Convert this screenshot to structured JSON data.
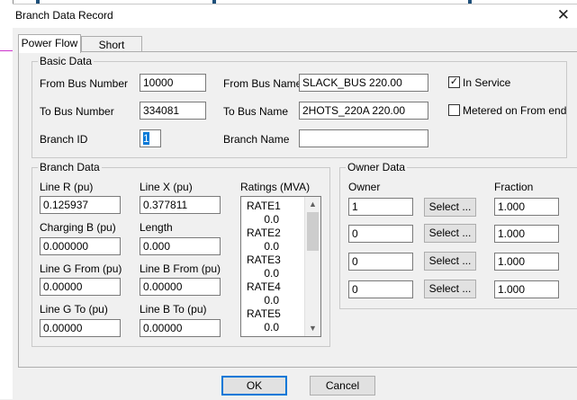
{
  "window": {
    "title": "Branch Data Record",
    "close_glyph": "✕"
  },
  "tabs": [
    {
      "label": "Power Flow",
      "active": true
    },
    {
      "label": "Short Circuit",
      "active": false
    }
  ],
  "basic_data": {
    "group_label": "Basic Data",
    "from_bus_number_label": "From Bus Number",
    "from_bus_number": "10000",
    "to_bus_number_label": "To Bus Number",
    "to_bus_number": "334081",
    "branch_id_label": "Branch ID",
    "branch_id": "1",
    "from_bus_name_label": "From Bus Name",
    "from_bus_name": "SLACK_BUS   220.00",
    "to_bus_name_label": "To Bus Name",
    "to_bus_name": "2HOTS_220A  220.00",
    "branch_name_label": "Branch Name",
    "branch_name": "",
    "in_service_label": "In Service",
    "in_service_checked": true,
    "metered_label": "Metered on From end",
    "metered_checked": false
  },
  "branch_data": {
    "group_label": "Branch Data",
    "line_r_label": "Line R (pu)",
    "line_r": "0.125937",
    "line_x_label": "Line X (pu)",
    "line_x": "0.377811",
    "charging_b_label": "Charging B (pu)",
    "charging_b": "0.000000",
    "length_label": "Length",
    "length": "0.000",
    "line_g_from_label": "Line G From (pu)",
    "line_g_from": "0.00000",
    "line_b_from_label": "Line B From (pu)",
    "line_b_from": "0.00000",
    "line_g_to_label": "Line G To (pu)",
    "line_g_to": "0.00000",
    "line_b_to_label": "Line B To (pu)",
    "line_b_to": "0.00000",
    "ratings_label": "Ratings (MVA)",
    "ratings": [
      {
        "name": "RATE1",
        "value": "0.0"
      },
      {
        "name": "RATE2",
        "value": "0.0"
      },
      {
        "name": "RATE3",
        "value": "0.0"
      },
      {
        "name": "RATE4",
        "value": "0.0"
      },
      {
        "name": "RATE5",
        "value": "0.0"
      }
    ]
  },
  "owner_data": {
    "group_label": "Owner Data",
    "owner_header": "Owner",
    "fraction_header": "Fraction",
    "select_label": "Select ...",
    "rows": [
      {
        "owner": "1",
        "fraction": "1.000"
      },
      {
        "owner": "0",
        "fraction": "1.000"
      },
      {
        "owner": "0",
        "fraction": "1.000"
      },
      {
        "owner": "0",
        "fraction": "1.000"
      }
    ]
  },
  "buttons": {
    "ok": "OK",
    "cancel": "Cancel"
  },
  "colors": {
    "accent": "#0078d7",
    "pink_line": "#cc33cc",
    "field_border": "#7a7a7a"
  }
}
